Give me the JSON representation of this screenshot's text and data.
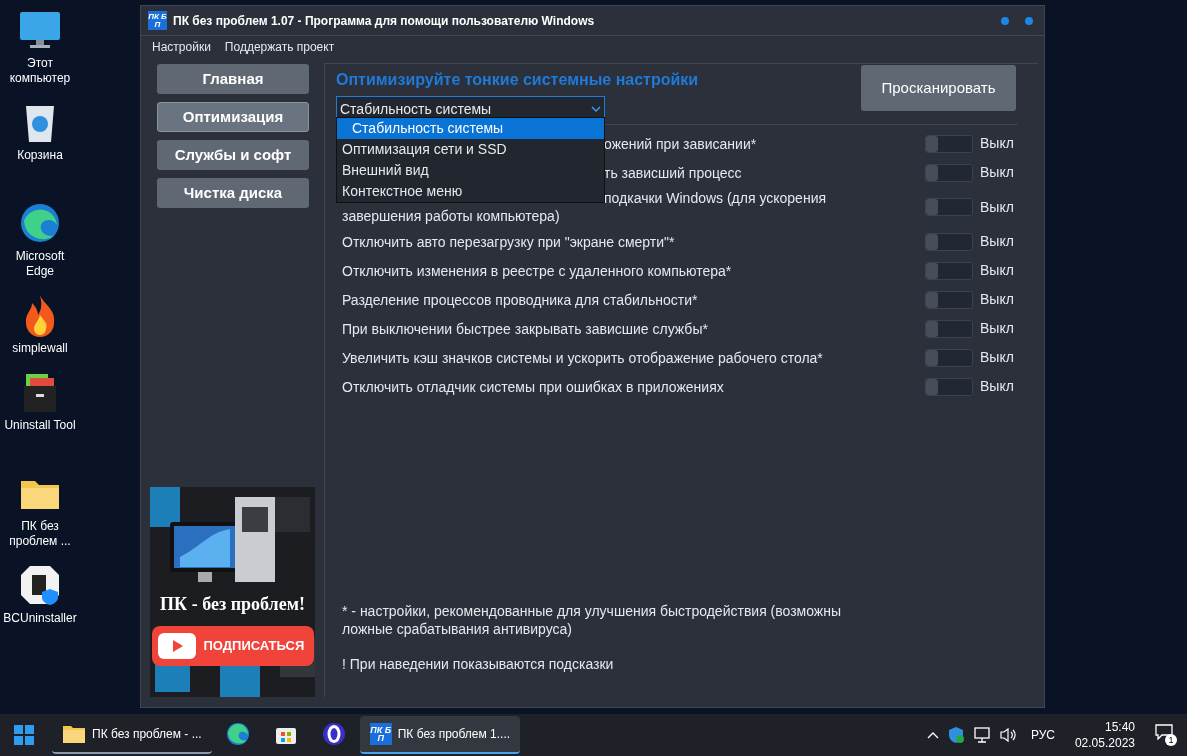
{
  "desktop_icons": [
    {
      "kind": "monitor",
      "label": "Этот компьютер"
    },
    {
      "kind": "bin",
      "label": "Корзина"
    },
    {
      "kind": "edge",
      "label": "Microsoft Edge"
    },
    {
      "kind": "flame",
      "label": "simplewall"
    },
    {
      "kind": "cabinet",
      "label": "Uninstall Tool"
    },
    {
      "kind": "folder",
      "label": "ПК без проблем ..."
    },
    {
      "kind": "bcu",
      "label": "BCUninstaller"
    }
  ],
  "window": {
    "logo": "ПК БП",
    "title": "ПК без проблем 1.07 - Программа для помощи пользователю Windows"
  },
  "menu": [
    "Настройки",
    "Поддержать проект"
  ],
  "nav": [
    {
      "label": "Главная",
      "selected": false
    },
    {
      "label": "Оптимизация",
      "selected": true
    },
    {
      "label": "Службы и софт",
      "selected": false
    },
    {
      "label": "Чистка диска",
      "selected": false
    }
  ],
  "banner": {
    "title": "ПК - без проблем!",
    "button": "ПОДПИСАТЬСЯ"
  },
  "heading": "Оптимизируйте тонкие системные настройки",
  "dropdown": {
    "value": "Стабильность системы",
    "expanded": true,
    "options": [
      {
        "label": "Стабильность системы",
        "selected": true
      },
      {
        "label": "Оптимизация сети и SSD",
        "selected": false
      },
      {
        "label": "Внешний вид",
        "selected": false
      },
      {
        "label": "Контекстное меню",
        "selected": false
      }
    ]
  },
  "scan_button": "Просканировать",
  "settings": [
    {
      "kind": "clipped",
      "lines": [
        "ожений при зависании*"
      ],
      "on": false,
      "state": "Выкл"
    },
    {
      "kind": "clipped",
      "lines": [
        "ть зависший процесс"
      ],
      "on": false,
      "state": "Выкл"
    },
    {
      "kind": "clipped",
      "lines": [
        "подкачки Windows (для ускорения",
        "завершения работы компьютера)"
      ],
      "on": false,
      "state": "Выкл"
    },
    {
      "kind": "full",
      "lines": [
        "Отключить авто перезагрузку при \"экране смерти\"*"
      ],
      "on": false,
      "state": "Выкл"
    },
    {
      "kind": "full",
      "lines": [
        "Отключить изменения в реестре с удаленного компьютера*"
      ],
      "on": false,
      "state": "Выкл"
    },
    {
      "kind": "full",
      "lines": [
        "Разделение процессов проводника для стабильности*"
      ],
      "on": false,
      "state": "Выкл"
    },
    {
      "kind": "full",
      "lines": [
        "При выключении быстрее закрывать зависшие службы*"
      ],
      "on": false,
      "state": "Выкл"
    },
    {
      "kind": "full",
      "lines": [
        "Увеличить кэш значков системы и ускорить отображение рабочего стола*"
      ],
      "on": false,
      "state": "Выкл"
    },
    {
      "kind": "full",
      "lines": [
        "Отключить отладчик системы при ошибках в приложениях"
      ],
      "on": false,
      "state": "Выкл"
    }
  ],
  "footnote": "* - настройки, рекомендованные для улучшения быстродействия (возможны ложные срабатывания антивируса)",
  "hint": "! При наведении показываются подсказки",
  "taskbar": {
    "apps": [
      {
        "kind": "folder",
        "label": "ПК без проблем - ...",
        "selected": false
      },
      {
        "kind": "edge",
        "selected": false
      },
      {
        "kind": "store",
        "selected": false
      },
      {
        "kind": "opera",
        "selected": false
      },
      {
        "kind": "app",
        "logo": "ПК БП",
        "label": "ПК без проблем 1....",
        "selected": true
      }
    ],
    "language": "РУС",
    "time": "15:40",
    "date": "02.05.2023",
    "notifications": "1"
  }
}
